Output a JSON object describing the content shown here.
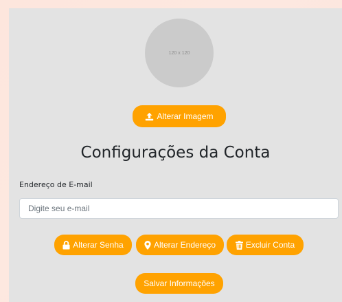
{
  "profile": {
    "avatar_placeholder": "120 x 120",
    "change_image_label": "Alterar Imagem",
    "change_image_icon": "upload-icon"
  },
  "page": {
    "title": "Configurações da Conta"
  },
  "email": {
    "label": "Endereço de E-mail",
    "value": "",
    "placeholder": "Digite seu e-mail"
  },
  "actions": {
    "change_password_label": "Alterar Senha",
    "change_password_icon": "lock-icon",
    "change_address_label": "Alterar Endereço",
    "change_address_icon": "map-marker-icon",
    "delete_account_label": "Excluir Conta",
    "delete_account_icon": "trash-icon",
    "save_label": "Salvar Informações"
  },
  "colors": {
    "accent": "#ffa200",
    "panel_background": "#e3e3e3",
    "avatar_background": "#cbcbcb"
  }
}
